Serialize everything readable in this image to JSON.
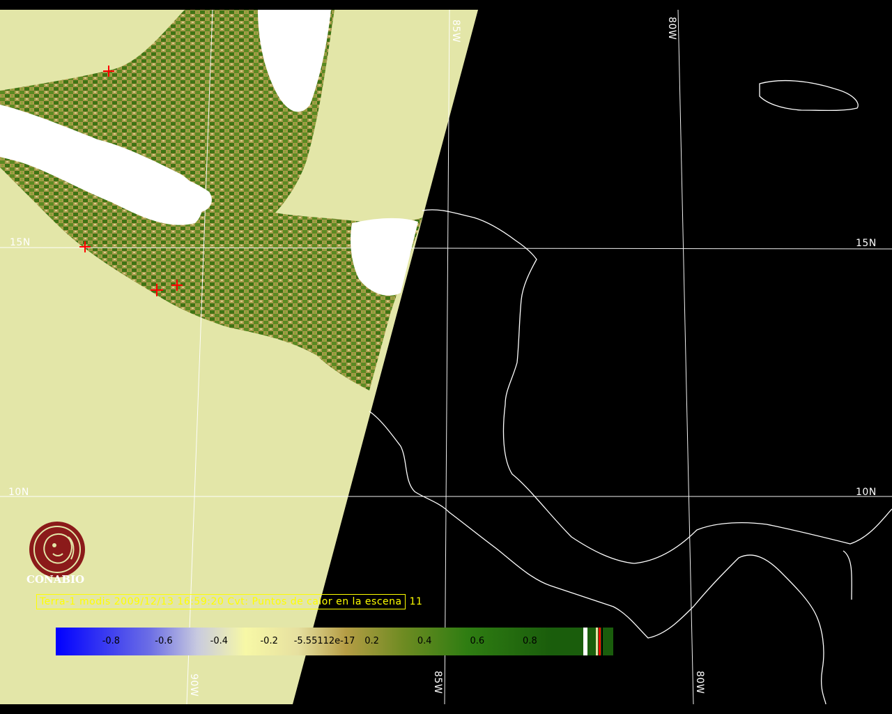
{
  "map": {
    "land_color": "#e3e6a8",
    "night_color": "#000000",
    "vegetation_color": "#4d7e1c",
    "cloud_color": "#ffffff",
    "coast_color": "#ffffff",
    "fire_color": "#ff0000",
    "graticule": {
      "lat_labels": [
        "15N",
        "10N"
      ],
      "lon_labels": [
        "90W",
        "85W",
        "80W"
      ]
    },
    "hotspot_count_shown": 5
  },
  "logo": {
    "name": "CONABIO",
    "color": "#8b1a1a"
  },
  "caption": {
    "text": "Terra-1 modis 2009/12/13 16:59:20 Cvt: Puntos de calor en la escena",
    "count": "11",
    "color": "#ffff00"
  },
  "colorbar": {
    "stops": [
      "#0000ff",
      "#c5c8e0",
      "#f3f3a0",
      "#e9e49c",
      "#b09a40",
      "#3d7f1a",
      "#1b5c0e"
    ],
    "tick_labels": [
      "-0.8",
      "-0.6",
      "-0.4",
      "-0.2",
      "-5.55112e-17",
      "0.2",
      "0.4",
      "0.6",
      "0.8"
    ]
  }
}
